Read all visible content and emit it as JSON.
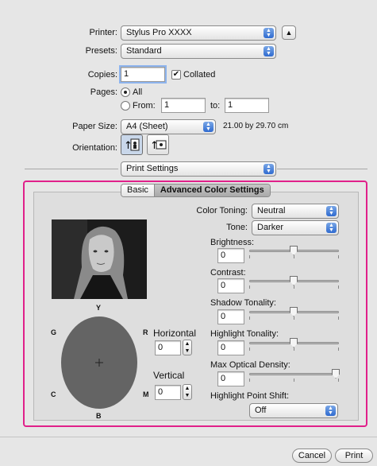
{
  "header": {
    "printer_label": "Printer:",
    "printer_value": "Stylus Pro XXXX",
    "presets_label": "Presets:",
    "presets_value": "Standard",
    "copies_label": "Copies:",
    "copies_value": "1",
    "collated_label": "Collated",
    "pages_label": "Pages:",
    "pages_all": "All",
    "pages_from": "From:",
    "pages_from_value": "1",
    "pages_to": "to:",
    "pages_to_value": "1",
    "paper_size_label": "Paper Size:",
    "paper_size_value": "A4 (Sheet)",
    "paper_dims": "21.00 by 29.70 cm",
    "orientation_label": "Orientation:"
  },
  "section_popup": "Print Settings",
  "tabs": {
    "basic": "Basic",
    "advanced": "Advanced Color Settings"
  },
  "color_wheel": {
    "Y": "Y",
    "R": "R",
    "M": "M",
    "B": "B",
    "C": "C",
    "G": "G",
    "horizontal_label": "Horizontal",
    "horizontal_value": "0",
    "vertical_label": "Vertical",
    "vertical_value": "0"
  },
  "controls": {
    "color_toning_label": "Color Toning:",
    "color_toning_value": "Neutral",
    "tone_label": "Tone:",
    "tone_value": "Darker",
    "brightness_label": "Brightness:",
    "brightness_value": "0",
    "contrast_label": "Contrast:",
    "contrast_value": "0",
    "shadow_label": "Shadow Tonality:",
    "shadow_value": "0",
    "highlight_label": "Highlight Tonality:",
    "highlight_value": "0",
    "max_density_label": "Max Optical Density:",
    "max_density_value": "0",
    "highlight_shift_label": "Highlight Point Shift:",
    "highlight_shift_value": "Off"
  },
  "footer": {
    "cancel": "Cancel",
    "print": "Print"
  },
  "colors": {
    "accent": "#e0208a",
    "wheel": "#646464",
    "blue": "#2f6bd0"
  }
}
